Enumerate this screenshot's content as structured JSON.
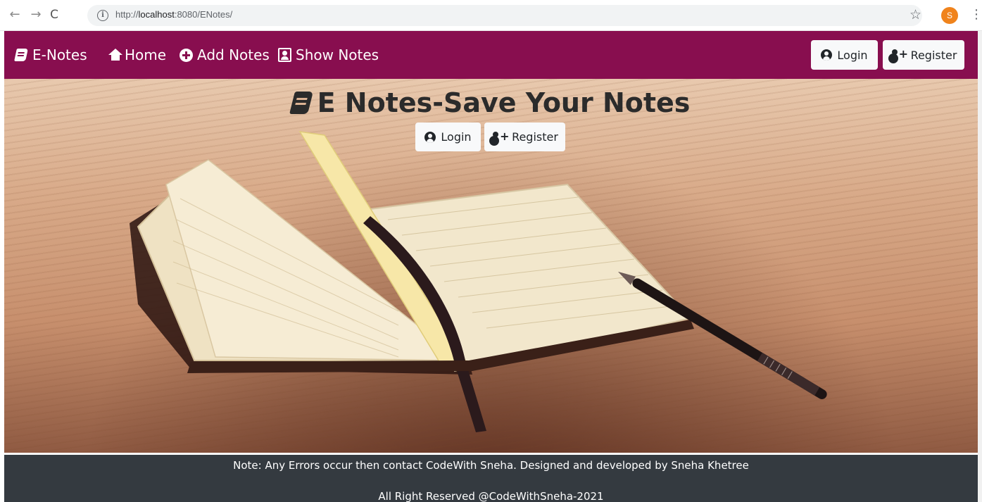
{
  "browser": {
    "url_prefix": "http://",
    "url_host": "localhost",
    "url_rest": ":8080/ENotes/",
    "profile_initial": "S"
  },
  "navbar": {
    "brand": "E-Notes",
    "links": [
      {
        "label": "Home",
        "icon": "home-icon"
      },
      {
        "label": "Add Notes",
        "icon": "plus-circle-icon"
      },
      {
        "label": "Show Notes",
        "icon": "address-book-icon"
      }
    ],
    "login_label": "Login",
    "register_label": "Register",
    "background_color": "#880e4f"
  },
  "hero": {
    "title": "E Notes-Save Your Notes",
    "login_label": "Login",
    "register_label": "Register"
  },
  "footer": {
    "line1": "Note: Any Errors occur then contact CodeWith Sneha. Designed and developed by Sneha Khetree",
    "line2": "All Right Reserved @CodeWithSneha-2021",
    "background_color": "#343a40"
  }
}
